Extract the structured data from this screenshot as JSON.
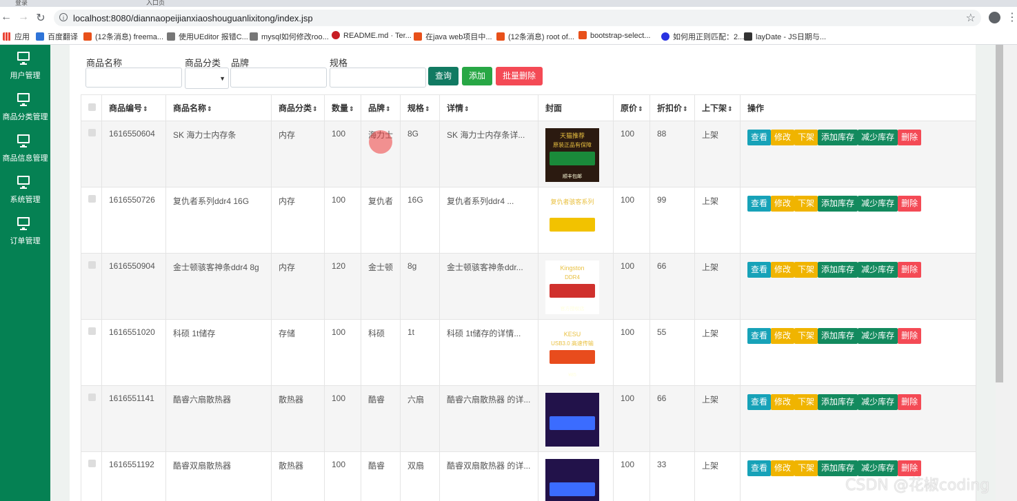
{
  "browser": {
    "tabs": [
      "登录",
      "入口页"
    ],
    "url": "localhost:8080/diannaopeijianxiaoshouguanlixitong/index.jsp",
    "bookmarks": [
      {
        "label": "应用",
        "color": "#ea4335"
      },
      {
        "label": "百度翻译",
        "color": "#2f74d8"
      },
      {
        "label": "(12条消息) freema...",
        "color": "#e8501a"
      },
      {
        "label": "使用UEditor 报错C...",
        "color": "#555555"
      },
      {
        "label": "mysql如何修改roo...",
        "color": "#555555"
      },
      {
        "label": "README.md · Ter...",
        "color": "#c71d23"
      },
      {
        "label": "在java web项目中...",
        "color": "#e8501a"
      },
      {
        "label": "(12条消息) root of...",
        "color": "#e8501a"
      },
      {
        "label": "bootstrap-select...",
        "color": "#e8501a"
      },
      {
        "label": "如何用正则匹配：2...",
        "color": "#2932e1"
      },
      {
        "label": "layDate - JS日期与...",
        "color": "#333333"
      }
    ]
  },
  "sidebar": {
    "items": [
      {
        "label": "用户管理"
      },
      {
        "label": "商品分类管理"
      },
      {
        "label": "商品信息管理"
      },
      {
        "label": "系统管理"
      },
      {
        "label": "订单管理"
      }
    ]
  },
  "filters": {
    "name_label": "商品名称",
    "category_label": "商品分类",
    "brand_label": "品牌",
    "spec_label": "规格",
    "query_button": "查询",
    "add_button": "添加",
    "batch_delete_button": "批量删除"
  },
  "table": {
    "headers": [
      "商品编号",
      "商品名称",
      "商品分类",
      "数量",
      "品牌",
      "规格",
      "详情",
      "封面",
      "原价",
      "折扣价",
      "上下架",
      "操作"
    ],
    "sort_icon": "⇕",
    "rows": [
      {
        "id": "1616550604",
        "name": "SK 海力士内存条",
        "category": "内存",
        "qty": "100",
        "brand": "海力士",
        "spec": "8G",
        "detail": "SK 海力士内存条详...",
        "price": "100",
        "discount": "88",
        "status": "上架"
      },
      {
        "id": "1616550726",
        "name": "复仇者系列ddr4 16G",
        "category": "内存",
        "qty": "100",
        "brand": "复仇者",
        "spec": "16G",
        "detail": "复仇者系列ddr4 ...",
        "price": "100",
        "discount": "99",
        "status": "上架"
      },
      {
        "id": "1616550904",
        "name": "金士顿骇客神条ddr4 8g",
        "category": "内存",
        "qty": "120",
        "brand": "金士顿",
        "spec": "8g",
        "detail": "金士顿骇客神条ddr...",
        "price": "100",
        "discount": "66",
        "status": "上架"
      },
      {
        "id": "1616551020",
        "name": "科硕 1t储存",
        "category": "存储",
        "qty": "100",
        "brand": "科硕",
        "spec": "1t",
        "detail": "科硕 1t储存的详情...",
        "price": "100",
        "discount": "55",
        "status": "上架"
      },
      {
        "id": "1616551141",
        "name": "酷睿六扇散热器",
        "category": "散热器",
        "qty": "100",
        "brand": "酷睿",
        "spec": "六扇",
        "detail": "酷睿六扇散热器 的详...",
        "price": "100",
        "discount": "66",
        "status": "上架"
      },
      {
        "id": "1616551192",
        "name": "酷睿双扇散热器",
        "category": "散热器",
        "qty": "100",
        "brand": "酷睿",
        "spec": "双扇",
        "detail": "酷睿双扇散热器 的详...",
        "price": "100",
        "discount": "33",
        "status": "上架"
      }
    ],
    "covers": [
      {
        "top_text": "天猫推荐",
        "sub_text": "原装正品有保障",
        "bottom_text": "顺丰包邮",
        "bg": "#2b1a10",
        "accent": "#1a8a3a"
      },
      {
        "top_text": "复仇者骇客系列",
        "sub_text": "",
        "bottom_text": "",
        "bg": "#ffffff",
        "accent": "#f2c200"
      },
      {
        "top_text": "Kingston",
        "sub_text": "DDR4",
        "bottom_text": "官方授权店",
        "bg": "#ffffff",
        "accent": "#d0312d"
      },
      {
        "top_text": "KESU",
        "sub_text": "USB3.0 高速传输",
        "bottom_text": "¥85",
        "bg": "#ffffff",
        "accent": "#e84c1d"
      },
      {
        "top_text": "",
        "sub_text": "",
        "bottom_text": "",
        "bg": "#22124a",
        "accent": "#3b6cff"
      },
      {
        "top_text": "",
        "sub_text": "",
        "bottom_text": "",
        "bg": "#22124a",
        "accent": "#3b6cff"
      }
    ],
    "actions": [
      "查看",
      "修改",
      "下架",
      "添加库存",
      "减少库存",
      "删除"
    ]
  },
  "watermark": "CSDN @花椒coding"
}
